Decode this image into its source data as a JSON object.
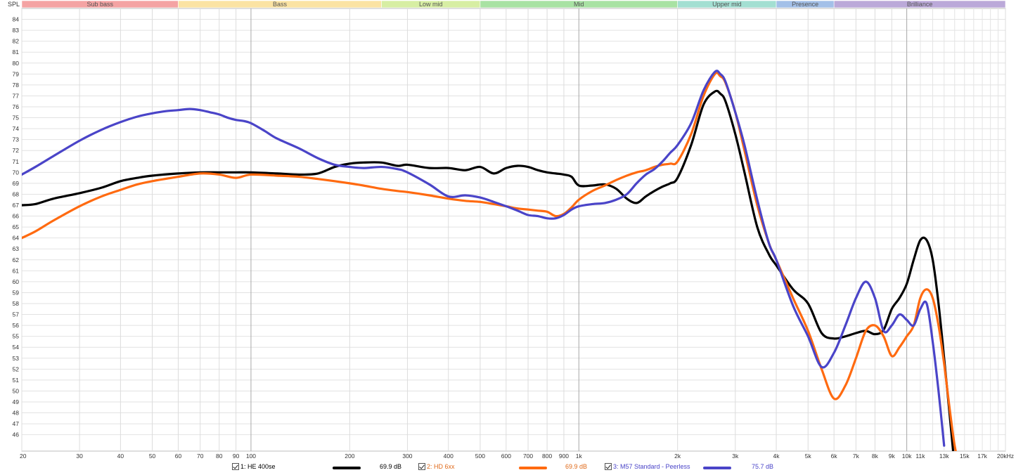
{
  "chart_data": {
    "type": "line",
    "ylabel": "SPL",
    "xscale": "log",
    "xlim": [
      20,
      20000
    ],
    "ylim": [
      44.5,
      85
    ],
    "grid": true,
    "yticks": [
      46,
      47,
      48,
      49,
      50,
      51,
      52,
      53,
      54,
      55,
      56,
      57,
      58,
      59,
      60,
      61,
      62,
      63,
      64,
      65,
      66,
      67,
      68,
      69,
      70,
      71,
      72,
      73,
      74,
      75,
      76,
      77,
      78,
      79,
      80,
      81,
      82,
      83,
      84
    ],
    "xticks": [
      {
        "v": 20,
        "label": "20"
      },
      {
        "v": 30,
        "label": "30"
      },
      {
        "v": 40,
        "label": "40"
      },
      {
        "v": 50,
        "label": "50"
      },
      {
        "v": 60,
        "label": "60"
      },
      {
        "v": 70,
        "label": "70"
      },
      {
        "v": 80,
        "label": "80"
      },
      {
        "v": 90,
        "label": "90"
      },
      {
        "v": 100,
        "label": "100"
      },
      {
        "v": 200,
        "label": "200"
      },
      {
        "v": 300,
        "label": "300"
      },
      {
        "v": 400,
        "label": "400"
      },
      {
        "v": 500,
        "label": "500"
      },
      {
        "v": 600,
        "label": "600"
      },
      {
        "v": 700,
        "label": "700"
      },
      {
        "v": 800,
        "label": "800"
      },
      {
        "v": 900,
        "label": "900"
      },
      {
        "v": 1000,
        "label": "1k"
      },
      {
        "v": 2000,
        "label": "2k"
      },
      {
        "v": 3000,
        "label": "3k"
      },
      {
        "v": 4000,
        "label": "4k"
      },
      {
        "v": 5000,
        "label": "5k"
      },
      {
        "v": 6000,
        "label": "6k"
      },
      {
        "v": 7000,
        "label": "7k"
      },
      {
        "v": 8000,
        "label": "8k"
      },
      {
        "v": 9000,
        "label": "9k"
      },
      {
        "v": 10000,
        "label": "10k"
      },
      {
        "v": 11000,
        "label": "11k"
      },
      {
        "v": 13000,
        "label": "13k"
      },
      {
        "v": 15000,
        "label": "15k"
      },
      {
        "v": 17000,
        "label": "17k"
      },
      {
        "v": 20000,
        "label": "20kHz"
      }
    ],
    "bands": [
      {
        "label": "Sub bass",
        "from": 20,
        "to": 60,
        "color": "#f4a3a3"
      },
      {
        "label": "Bass",
        "from": 60,
        "to": 250,
        "color": "#fbe3a3"
      },
      {
        "label": "Low mid",
        "from": 250,
        "to": 500,
        "color": "#d7eea3"
      },
      {
        "label": "Mid",
        "from": 500,
        "to": 2000,
        "color": "#a8e2a3"
      },
      {
        "label": "Upper mid",
        "from": 2000,
        "to": 4000,
        "color": "#a3dfd2"
      },
      {
        "label": "Presence",
        "from": 4000,
        "to": 6000,
        "color": "#a3c0e8"
      },
      {
        "label": "Brilliance",
        "from": 6000,
        "to": 20000,
        "color": "#bba9d9"
      }
    ],
    "series": [
      {
        "name": "1: HE 400se",
        "value_label": "69.9 dB",
        "color": "#000000",
        "label_color": "#000000",
        "x": [
          20,
          22,
          25,
          30,
          35,
          40,
          45,
          50,
          60,
          70,
          80,
          90,
          100,
          120,
          140,
          160,
          180,
          200,
          220,
          250,
          280,
          300,
          350,
          400,
          450,
          500,
          550,
          600,
          650,
          700,
          750,
          800,
          850,
          900,
          950,
          1000,
          1100,
          1200,
          1300,
          1400,
          1500,
          1600,
          1700,
          1800,
          1900,
          2000,
          2200,
          2400,
          2600,
          2700,
          2800,
          3000,
          3200,
          3500,
          3800,
          4000,
          4500,
          5000,
          5500,
          6000,
          6500,
          7000,
          7500,
          8000,
          8500,
          9000,
          9500,
          10000,
          10500,
          11000,
          11500,
          12000,
          12500,
          13000,
          13500,
          14000
        ],
        "y": [
          67.0,
          67.1,
          67.6,
          68.1,
          68.6,
          69.2,
          69.5,
          69.7,
          69.9,
          70.0,
          70.0,
          70.0,
          70.0,
          69.9,
          69.8,
          69.9,
          70.5,
          70.8,
          70.9,
          70.9,
          70.6,
          70.7,
          70.4,
          70.4,
          70.2,
          70.5,
          69.9,
          70.4,
          70.6,
          70.5,
          70.2,
          70.0,
          69.9,
          69.8,
          69.6,
          68.8,
          68.8,
          68.9,
          68.5,
          67.6,
          67.2,
          67.8,
          68.3,
          68.7,
          69.0,
          69.5,
          72.5,
          76.2,
          77.4,
          77.2,
          76.5,
          73.5,
          70.0,
          65.0,
          62.5,
          61.5,
          59.3,
          58.0,
          55.3,
          54.8,
          55.0,
          55.3,
          55.5,
          55.2,
          55.6,
          57.5,
          58.5,
          59.8,
          62.0,
          63.8,
          63.8,
          62.0,
          58.0,
          53.0,
          48.0,
          43.0
        ]
      },
      {
        "name": "2: HD 6xx",
        "value_label": "69.9 dB",
        "color": "#ff6a10",
        "label_color": "#e06a1a",
        "x": [
          20,
          22,
          25,
          30,
          35,
          40,
          45,
          50,
          60,
          70,
          80,
          90,
          100,
          120,
          140,
          160,
          180,
          200,
          220,
          250,
          280,
          300,
          350,
          400,
          450,
          500,
          550,
          600,
          650,
          700,
          750,
          800,
          850,
          900,
          950,
          1000,
          1100,
          1200,
          1300,
          1400,
          1500,
          1600,
          1700,
          1800,
          1900,
          2000,
          2200,
          2400,
          2600,
          2700,
          2800,
          3000,
          3200,
          3500,
          3800,
          4000,
          4500,
          5000,
          5500,
          6000,
          6500,
          7000,
          7500,
          8000,
          8500,
          9000,
          9500,
          10000,
          10500,
          11000,
          11500,
          12000,
          12500,
          13000,
          13500,
          14000,
          14500
        ],
        "y": [
          64.0,
          64.6,
          65.6,
          66.9,
          67.8,
          68.4,
          68.9,
          69.2,
          69.6,
          69.9,
          69.8,
          69.5,
          69.8,
          69.7,
          69.6,
          69.4,
          69.2,
          69.0,
          68.8,
          68.5,
          68.3,
          68.2,
          67.9,
          67.6,
          67.4,
          67.3,
          67.1,
          66.9,
          66.7,
          66.6,
          66.5,
          66.4,
          66.0,
          66.2,
          66.8,
          67.5,
          68.3,
          68.8,
          69.3,
          69.7,
          70.0,
          70.2,
          70.5,
          70.7,
          70.8,
          71.0,
          73.5,
          77.0,
          79.0,
          78.8,
          78.2,
          75.5,
          72.0,
          67.0,
          63.5,
          62.0,
          58.5,
          55.5,
          52.0,
          49.3,
          50.5,
          53.0,
          55.5,
          56.0,
          55.0,
          53.2,
          54.0,
          55.0,
          56.0,
          58.5,
          59.3,
          58.5,
          56.0,
          52.5,
          48.5,
          45.0,
          43.0
        ]
      },
      {
        "name": "3: M57 Standard - Peerless",
        "value_label": "75.7 dB",
        "color": "#4a44c8",
        "label_color": "#4a44c8",
        "x": [
          20,
          22,
          25,
          30,
          35,
          40,
          45,
          50,
          55,
          60,
          65,
          70,
          75,
          80,
          85,
          90,
          95,
          100,
          110,
          120,
          140,
          160,
          180,
          200,
          220,
          250,
          280,
          300,
          350,
          400,
          450,
          500,
          550,
          600,
          650,
          700,
          750,
          800,
          850,
          900,
          950,
          1000,
          1100,
          1200,
          1300,
          1400,
          1500,
          1600,
          1700,
          1800,
          1900,
          2000,
          2200,
          2400,
          2600,
          2700,
          2800,
          3000,
          3200,
          3500,
          3800,
          4000,
          4500,
          5000,
          5500,
          6000,
          6500,
          7000,
          7500,
          8000,
          8500,
          9000,
          9500,
          10000,
          10500,
          11000,
          11500,
          12000,
          12500,
          13000
        ],
        "y": [
          69.8,
          70.5,
          71.5,
          72.9,
          73.9,
          74.6,
          75.1,
          75.4,
          75.6,
          75.7,
          75.8,
          75.7,
          75.5,
          75.3,
          75.0,
          74.8,
          74.7,
          74.5,
          73.8,
          73.1,
          72.2,
          71.3,
          70.7,
          70.5,
          70.4,
          70.5,
          70.3,
          70.0,
          68.9,
          67.8,
          67.9,
          67.7,
          67.3,
          66.9,
          66.5,
          66.1,
          66.0,
          65.8,
          65.8,
          66.1,
          66.6,
          66.9,
          67.1,
          67.2,
          67.5,
          68.0,
          69.0,
          69.8,
          70.3,
          71.0,
          71.8,
          72.5,
          74.5,
          77.5,
          79.2,
          79.0,
          78.3,
          75.5,
          72.5,
          67.5,
          63.5,
          62.0,
          57.8,
          55.0,
          52.2,
          53.5,
          56.0,
          58.5,
          60.0,
          58.5,
          55.5,
          56.0,
          57.0,
          56.5,
          56.0,
          57.5,
          58.0,
          54.5,
          50.0,
          45.0
        ]
      }
    ]
  }
}
